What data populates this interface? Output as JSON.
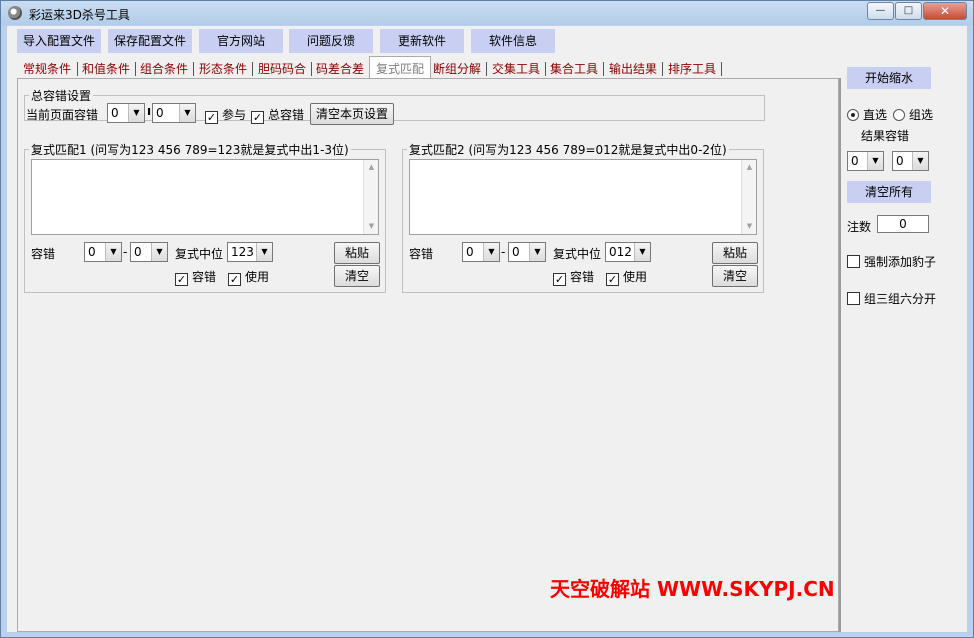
{
  "window": {
    "title": "彩运来3D杀号工具"
  },
  "caption": {
    "minimize": "—",
    "maximize": "□",
    "close": "✕"
  },
  "toolbar": [
    "导入配置文件",
    "保存配置文件",
    "官方网站",
    "问题反馈",
    "更新软件",
    "软件信息"
  ],
  "tabs": [
    "常规条件",
    "和值条件",
    "组合条件",
    "形态条件",
    "胆码码合",
    "码差合差",
    "复式匹配",
    "断组分解",
    "交集工具",
    "集合工具",
    "输出结果",
    "排序工具"
  ],
  "active_tab": "复式匹配",
  "total_error": {
    "legend": "总容错设置",
    "label": "当前页面容错",
    "min": "0",
    "max": "0",
    "participate_label": "参与",
    "participate_checked": true,
    "total_error_label": "总容错",
    "total_error_checked": true,
    "clear_button": "清空本页设置"
  },
  "match1": {
    "legend": "复式匹配1 (问写为123 456 789=123就是复式中出1-3位)",
    "error_label": "容错",
    "error_min": "0",
    "error_max": "0",
    "position_label": "复式中位",
    "position_value": "123",
    "paste_button": "粘贴",
    "clear_button": "清空",
    "chk_error_label": "容错",
    "chk_error_checked": true,
    "chk_use_label": "使用",
    "chk_use_checked": true
  },
  "match2": {
    "legend": "复式匹配2 (问写为123 456 789=012就是复式中出0-2位)",
    "error_label": "容错",
    "error_min": "0",
    "error_max": "0",
    "position_label": "复式中位",
    "position_value": "012",
    "paste_button": "粘贴",
    "clear_button": "清空",
    "chk_error_label": "容错",
    "chk_error_checked": true,
    "chk_use_label": "使用",
    "chk_use_checked": true
  },
  "sidebar": {
    "start_button": "开始缩水",
    "radio_direct": "直选",
    "radio_group": "组选",
    "radio_selected": "直选",
    "result_error_label": "结果容错",
    "result_min": "0",
    "result_max": "0",
    "clear_all_button": "清空所有",
    "count_label": "注数",
    "count_value": "0",
    "force_leopard_label": "强制添加豹子",
    "force_leopard_checked": false,
    "split_group_label": "组三组六分开",
    "split_group_checked": false
  },
  "watermark": "天空破解站 WWW.SKYPJ.CN",
  "icons": {
    "combo_arrow": "▼",
    "scroll_up": "▲",
    "scroll_down": "▼",
    "check": "✓"
  }
}
